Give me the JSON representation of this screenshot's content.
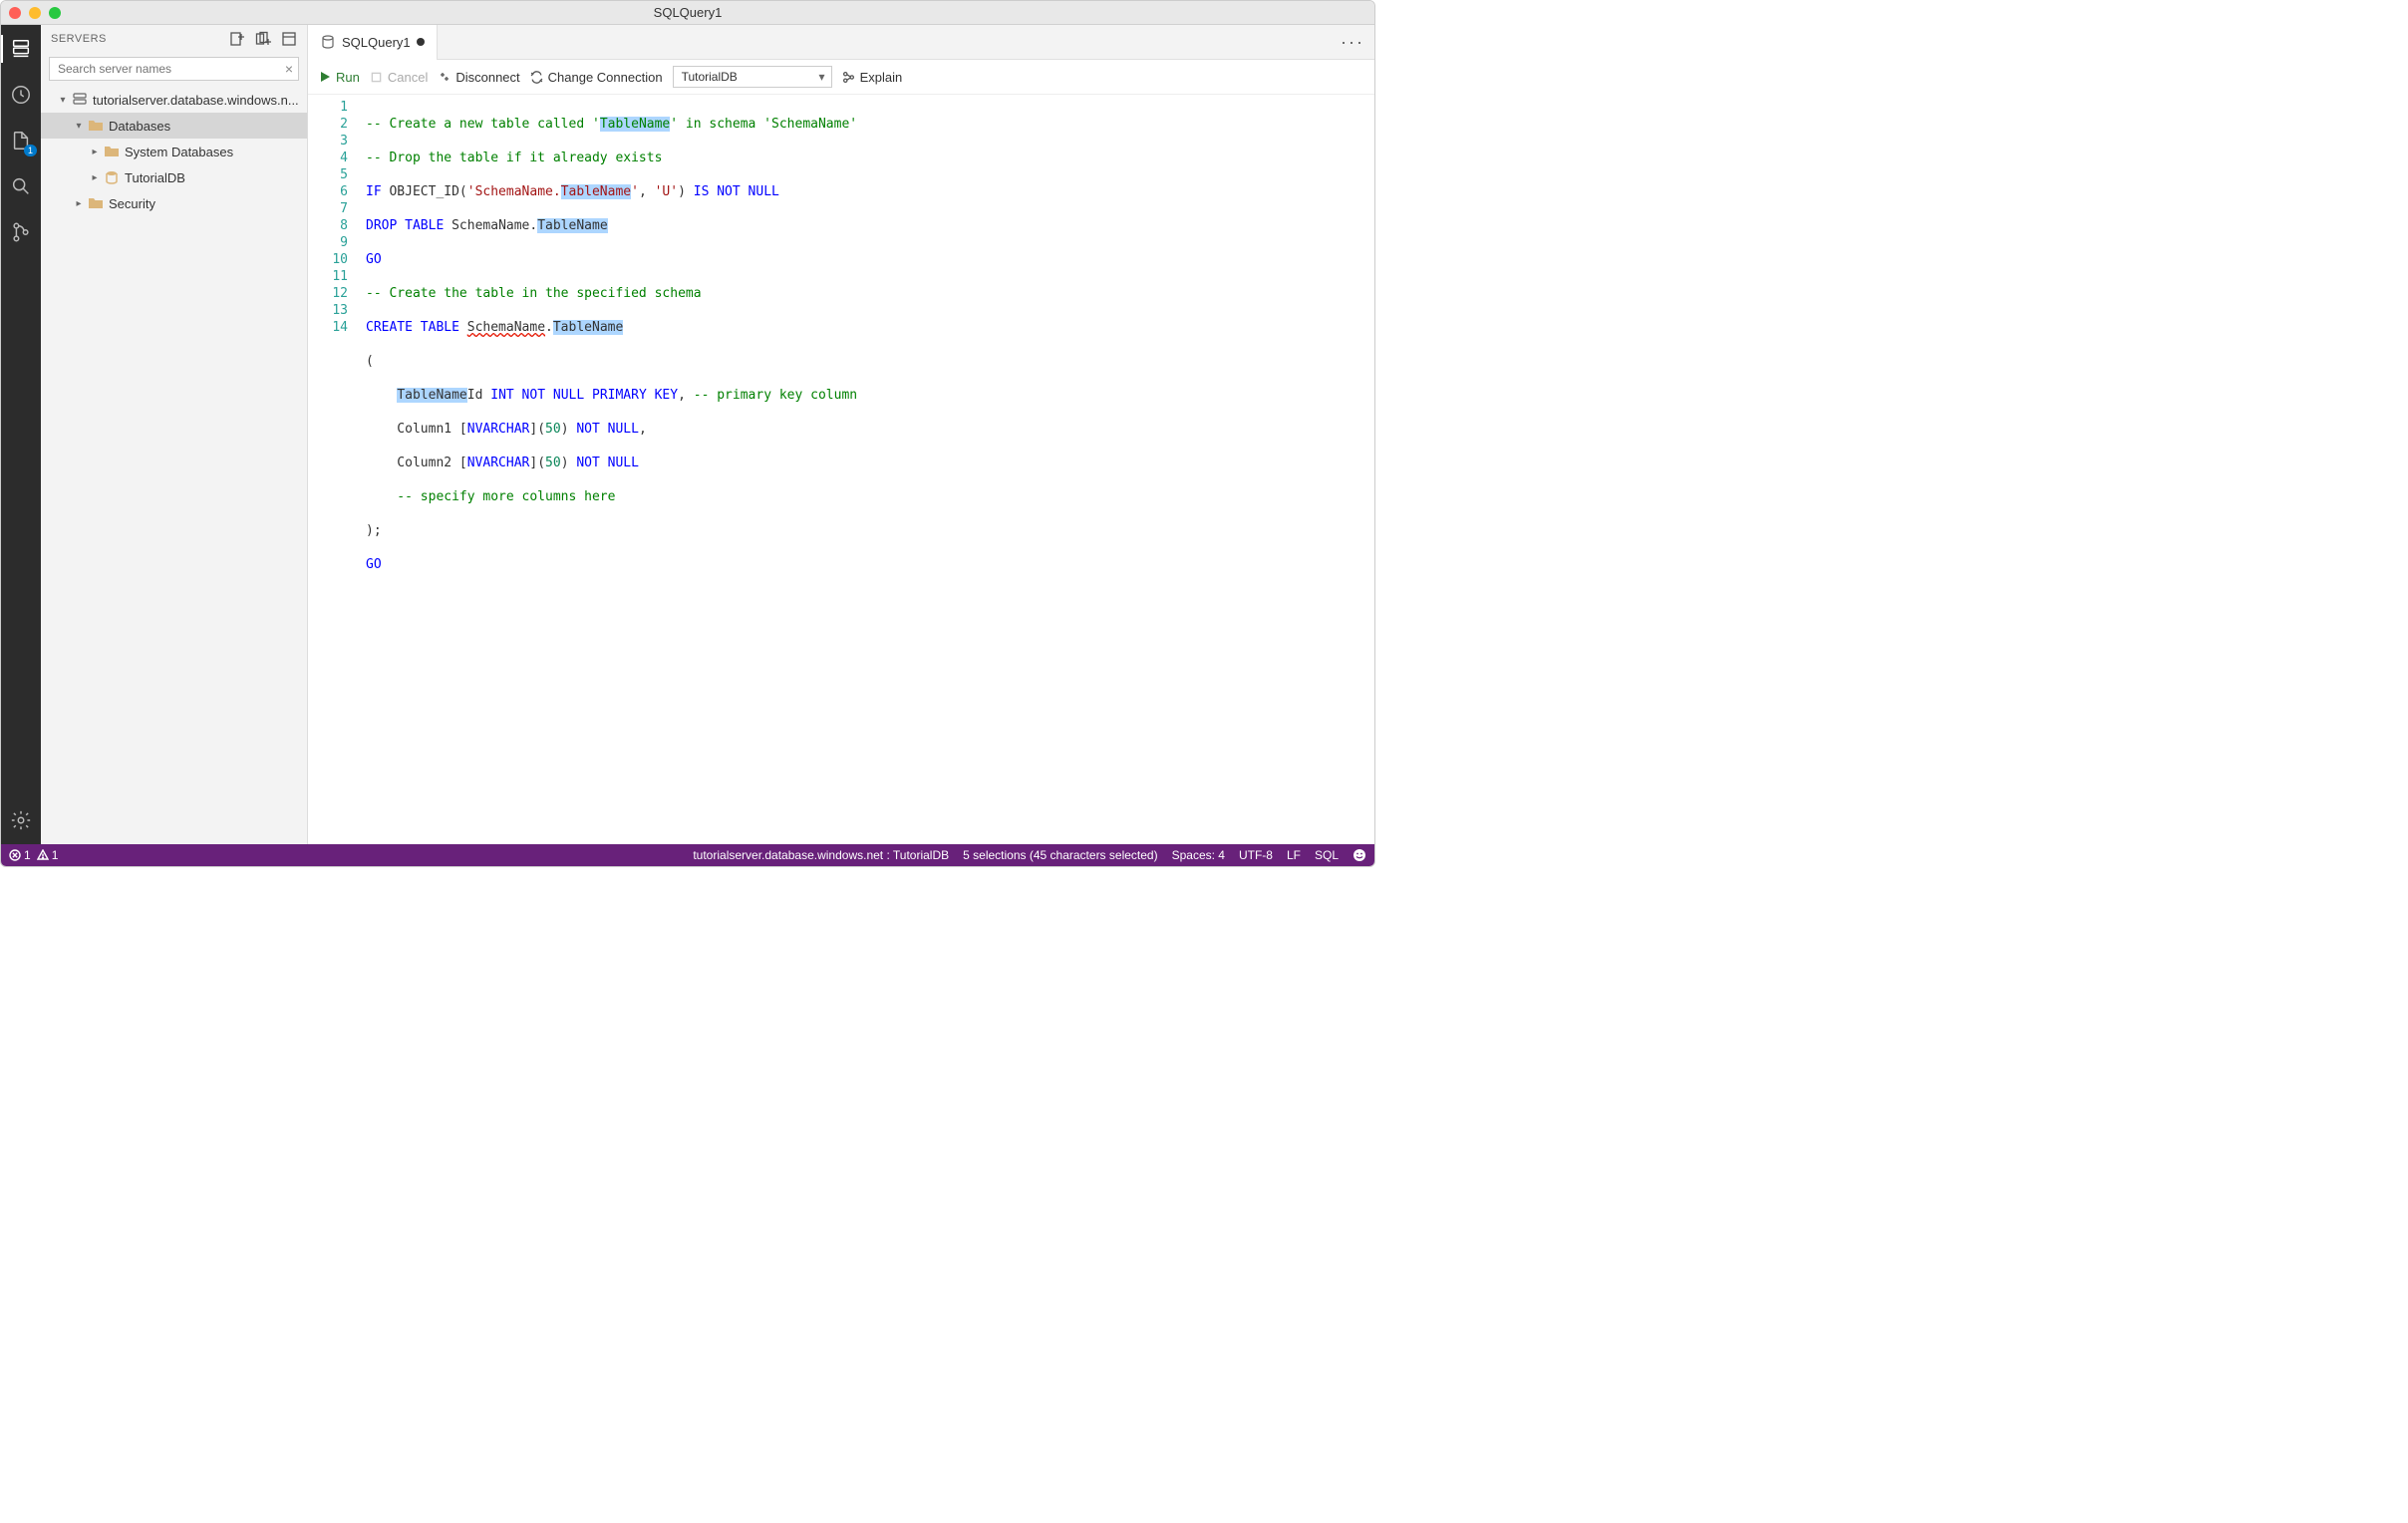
{
  "title": "SQLQuery1",
  "sidebar": {
    "title": "SERVERS",
    "search_placeholder": "Search server names",
    "server": "tutorialserver.database.windows.n...",
    "nodes": {
      "databases": "Databases",
      "system_databases": "System Databases",
      "tutorialdb": "TutorialDB",
      "security": "Security"
    }
  },
  "tab": {
    "label": "SQLQuery1"
  },
  "toolbar": {
    "run": "Run",
    "cancel": "Cancel",
    "disconnect": "Disconnect",
    "change_connection": "Change Connection",
    "database": "TutorialDB",
    "explain": "Explain"
  },
  "code": {
    "l1_a": "-- Create a new table called '",
    "l1_b": "TableName",
    "l1_c": "' in schema '",
    "l1_d": "SchemaName",
    "l1_e": "'",
    "l2": "-- Drop the table if it already exists",
    "l3_a": "IF",
    "l3_b": " OBJECT_ID(",
    "l3_c": "'SchemaName.",
    "l3_d": "TableName",
    "l3_e": "'",
    "l3_f": ", ",
    "l3_g": "'U'",
    "l3_h": ") ",
    "l3_i": "IS NOT NULL",
    "l4_a": "DROP TABLE",
    "l4_b": " SchemaName.",
    "l4_c": "TableName",
    "l5": "GO",
    "l6": "-- Create the table in the specified schema",
    "l7_a": "CREATE TABLE",
    "l7_b": " ",
    "l7_c": "SchemaName",
    "l7_d": ".",
    "l7_e": "TableName",
    "l8": "(",
    "l9_a": "    ",
    "l9_b": "TableName",
    "l9_c": "Id ",
    "l9_d": "INT NOT NULL PRIMARY KEY",
    "l9_e": ", ",
    "l9_f": "-- primary key column",
    "l10_a": "    Column1 [",
    "l10_b": "NVARCHAR",
    "l10_c": "](",
    "l10_d": "50",
    "l10_e": ") ",
    "l10_f": "NOT NULL",
    "l10_g": ",",
    "l11_a": "    Column2 [",
    "l11_b": "NVARCHAR",
    "l11_c": "](",
    "l11_d": "50",
    "l11_e": ") ",
    "l11_f": "NOT NULL",
    "l12": "    -- specify more columns here",
    "l13": ");",
    "l14": "GO"
  },
  "status": {
    "errors": "1",
    "warnings": "1",
    "connection": "tutorialserver.database.windows.net : TutorialDB",
    "selections": "5 selections (45 characters selected)",
    "spaces": "Spaces: 4",
    "encoding": "UTF-8",
    "eol": "LF",
    "lang": "SQL"
  }
}
